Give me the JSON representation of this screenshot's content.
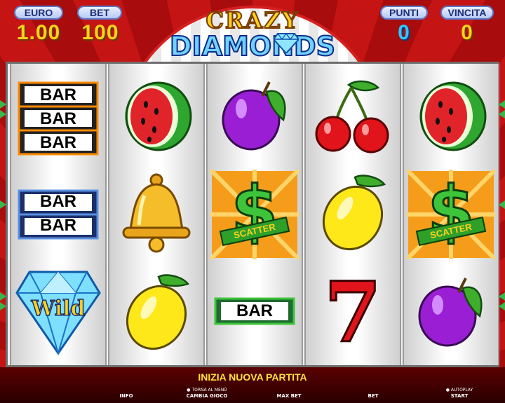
{
  "header": {
    "euro_label": "EURO",
    "euro_value": "1.00",
    "bet_label": "BET",
    "bet_value": "100",
    "punti_label": "PUNTI",
    "punti_value": "0",
    "vincita_label": "VINCITA",
    "vincita_value": "0"
  },
  "logo": {
    "line1": "CRAZY",
    "line2": "DIAMONDS"
  },
  "reels": [
    [
      "bar-triple",
      "bar-double",
      "wild-diamond"
    ],
    [
      "watermelon",
      "bell",
      "lemon"
    ],
    [
      "plum",
      "scatter-dollar",
      "bar-single"
    ],
    [
      "cherries",
      "lemon",
      "seven"
    ],
    [
      "watermelon",
      "scatter-dollar",
      "plum"
    ]
  ],
  "symbols": {
    "bar": "BAR",
    "wild": "Wild",
    "scatter": "SCATTER",
    "seven": "7",
    "dollar": "$"
  },
  "status": "INIZIA NUOVA PARTITA",
  "buttons": {
    "info": "INFO",
    "cambia_gioco": "CAMBIA GIOCO",
    "torna_menu": "● TORNA AL MENÙ",
    "max_bet": "MAX BET",
    "bet": "BET",
    "start": "START",
    "autoplay": "● AUTOPLAY"
  },
  "colors": {
    "value_yellow": "#ffd21c",
    "value_blue": "#2fc6ff",
    "status_yellow": "#ffe23a",
    "payline_green": "#36b84a"
  }
}
